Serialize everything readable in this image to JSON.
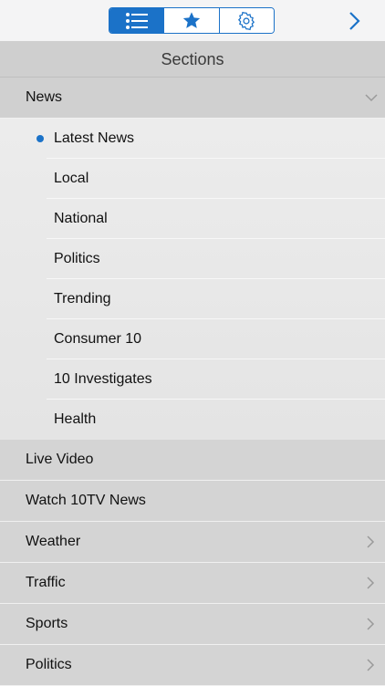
{
  "toolbar": {
    "tabs": [
      {
        "icon": "list-icon",
        "active": true
      },
      {
        "icon": "star-icon",
        "active": false
      },
      {
        "icon": "gear-icon",
        "active": false
      }
    ],
    "forward_icon": "chevron-right-icon",
    "accent": "#1b72c8"
  },
  "header": {
    "title": "Sections"
  },
  "sections": {
    "news": {
      "label": "News",
      "expanded": true,
      "children": [
        "Latest News",
        "Local",
        "National",
        "Politics",
        "Trending",
        "Consumer 10",
        "10 Investigates",
        "Health"
      ],
      "selected": "Latest News"
    },
    "items": [
      {
        "label": "Live Video",
        "has_chevron": false
      },
      {
        "label": "Watch 10TV News",
        "has_chevron": false
      },
      {
        "label": "Weather",
        "has_chevron": true
      },
      {
        "label": "Traffic",
        "has_chevron": true
      },
      {
        "label": "Sports",
        "has_chevron": true
      },
      {
        "label": "Politics",
        "has_chevron": true
      }
    ]
  }
}
